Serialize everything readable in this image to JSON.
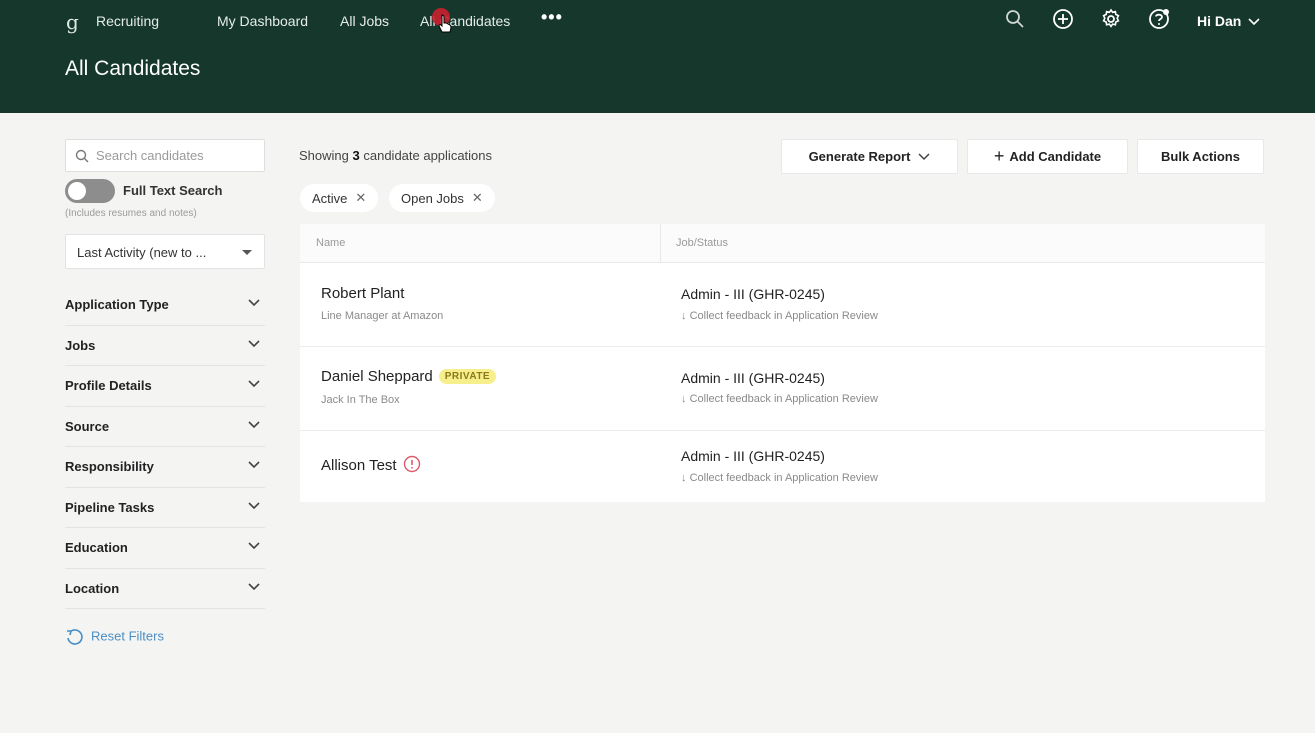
{
  "header": {
    "app_name": "Recruiting",
    "nav": [
      "My Dashboard",
      "All Jobs",
      "All Candidates"
    ],
    "more": "•••",
    "user": "Hi Dan",
    "page_title": "All Candidates",
    "icons": [
      "search-icon",
      "add-circle-icon",
      "gear-icon",
      "help-icon"
    ]
  },
  "sidebar": {
    "search_placeholder": "Search candidates",
    "toggle_label": "Full Text Search",
    "toggle_sub": "(Includes resumes and notes)",
    "sort_value": "Last Activity (new to ...",
    "filters": [
      "Application Type",
      "Jobs",
      "Profile Details",
      "Source",
      "Responsibility",
      "Pipeline Tasks",
      "Education",
      "Location"
    ],
    "reset": "Reset Filters"
  },
  "main": {
    "showing_prefix": "Showing",
    "showing_count": "3",
    "showing_suffix": "candidate applications",
    "buttons": {
      "generate_report": "Generate Report",
      "add_candidate": "Add Candidate",
      "bulk_actions": "Bulk Actions"
    },
    "chips": [
      "Active",
      "Open Jobs"
    ],
    "columns": [
      "Name",
      "Job/Status"
    ],
    "rows": [
      {
        "name": "Robert Plant",
        "sub": "Line Manager at Amazon",
        "badge": "",
        "job": "Admin - III (GHR-0245)",
        "status": "Collect feedback in Application Review"
      },
      {
        "name": "Daniel Sheppard",
        "sub": "Jack In The Box",
        "badge": "PRIVATE",
        "job": "Admin - III (GHR-0245)",
        "status": "Collect feedback in Application Review"
      },
      {
        "name": "Allison Test",
        "sub": "",
        "badge": "",
        "job": "Admin - III (GHR-0245)",
        "status": "Collect feedback in Application Review"
      }
    ]
  },
  "colors": {
    "header_bg": "#15372c",
    "badge_bg": "#f7ef8c",
    "link": "#4a8fc4",
    "alert": "#e05a6a"
  }
}
